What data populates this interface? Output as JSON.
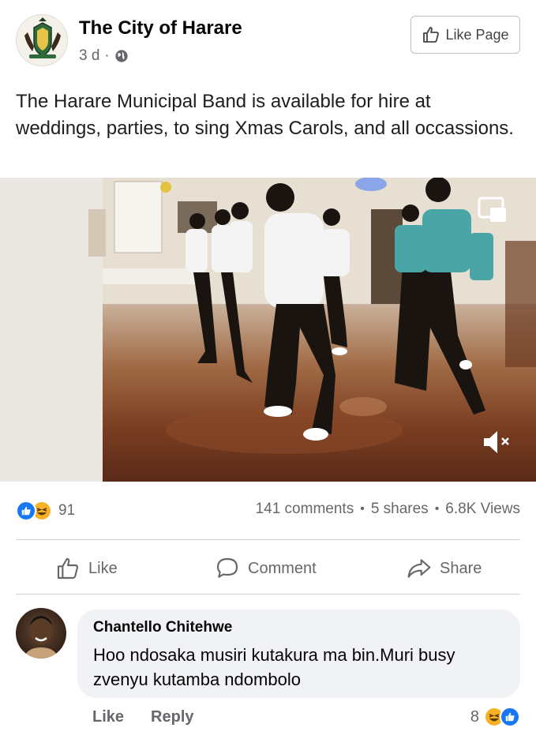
{
  "post": {
    "page_name": "The City of Harare",
    "age": "3 d",
    "privacy_icon": "globe-icon",
    "like_page_label": "Like Page",
    "text": "The Harare Municipal Band is available for hire at weddings, parties, to sing Xmas Carols, and all occassions."
  },
  "video": {
    "pip_icon": "picture-in-picture-icon",
    "mute_icon": "muted-speaker-icon"
  },
  "stats": {
    "reaction_count": "91",
    "comments": "141 comments",
    "shares": "5 shares",
    "views": "6.8K Views"
  },
  "actions": {
    "like": "Like",
    "comment": "Comment",
    "share": "Share"
  },
  "comment": {
    "author": "Chantello Chitehwe",
    "text": "Hoo ndosaka musiri kutakura ma bin.Muri busy zvenyu kutamba ndombolo",
    "like_label": "Like",
    "reply_label": "Reply",
    "reaction_count": "8"
  },
  "colors": {
    "facebook_blue": "#1877f2",
    "haha_yellow": "#f7b125",
    "muted_text": "#65676b",
    "bubble_bg": "#f0f2f5"
  }
}
